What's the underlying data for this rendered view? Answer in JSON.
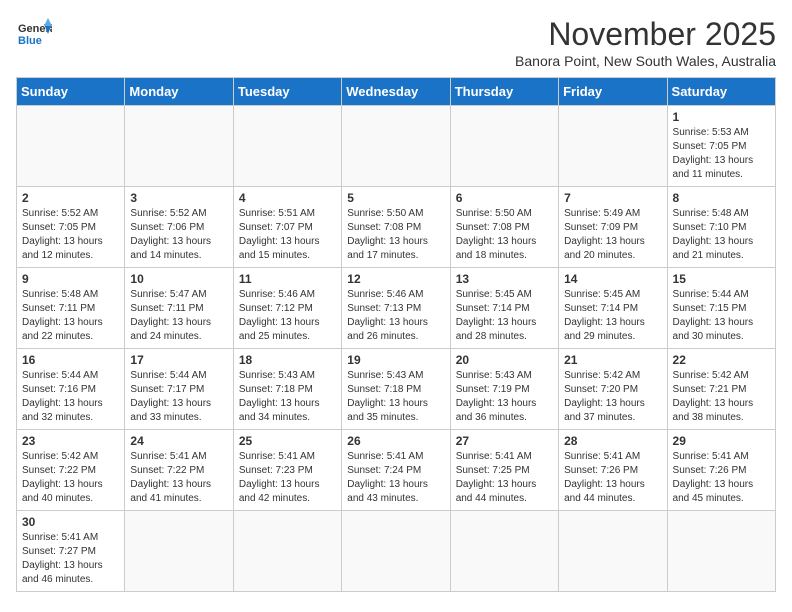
{
  "header": {
    "logo_general": "General",
    "logo_blue": "Blue",
    "month_title": "November 2025",
    "subtitle": "Banora Point, New South Wales, Australia"
  },
  "days_of_week": [
    "Sunday",
    "Monday",
    "Tuesday",
    "Wednesday",
    "Thursday",
    "Friday",
    "Saturday"
  ],
  "weeks": [
    [
      {
        "day": "",
        "info": ""
      },
      {
        "day": "",
        "info": ""
      },
      {
        "day": "",
        "info": ""
      },
      {
        "day": "",
        "info": ""
      },
      {
        "day": "",
        "info": ""
      },
      {
        "day": "",
        "info": ""
      },
      {
        "day": "1",
        "info": "Sunrise: 5:53 AM\nSunset: 7:05 PM\nDaylight: 13 hours and 11 minutes."
      }
    ],
    [
      {
        "day": "2",
        "info": "Sunrise: 5:52 AM\nSunset: 7:05 PM\nDaylight: 13 hours and 12 minutes."
      },
      {
        "day": "3",
        "info": "Sunrise: 5:52 AM\nSunset: 7:06 PM\nDaylight: 13 hours and 14 minutes."
      },
      {
        "day": "4",
        "info": "Sunrise: 5:51 AM\nSunset: 7:07 PM\nDaylight: 13 hours and 15 minutes."
      },
      {
        "day": "5",
        "info": "Sunrise: 5:50 AM\nSunset: 7:08 PM\nDaylight: 13 hours and 17 minutes."
      },
      {
        "day": "6",
        "info": "Sunrise: 5:50 AM\nSunset: 7:08 PM\nDaylight: 13 hours and 18 minutes."
      },
      {
        "day": "7",
        "info": "Sunrise: 5:49 AM\nSunset: 7:09 PM\nDaylight: 13 hours and 20 minutes."
      },
      {
        "day": "8",
        "info": "Sunrise: 5:48 AM\nSunset: 7:10 PM\nDaylight: 13 hours and 21 minutes."
      }
    ],
    [
      {
        "day": "9",
        "info": "Sunrise: 5:48 AM\nSunset: 7:11 PM\nDaylight: 13 hours and 22 minutes."
      },
      {
        "day": "10",
        "info": "Sunrise: 5:47 AM\nSunset: 7:11 PM\nDaylight: 13 hours and 24 minutes."
      },
      {
        "day": "11",
        "info": "Sunrise: 5:46 AM\nSunset: 7:12 PM\nDaylight: 13 hours and 25 minutes."
      },
      {
        "day": "12",
        "info": "Sunrise: 5:46 AM\nSunset: 7:13 PM\nDaylight: 13 hours and 26 minutes."
      },
      {
        "day": "13",
        "info": "Sunrise: 5:45 AM\nSunset: 7:14 PM\nDaylight: 13 hours and 28 minutes."
      },
      {
        "day": "14",
        "info": "Sunrise: 5:45 AM\nSunset: 7:14 PM\nDaylight: 13 hours and 29 minutes."
      },
      {
        "day": "15",
        "info": "Sunrise: 5:44 AM\nSunset: 7:15 PM\nDaylight: 13 hours and 30 minutes."
      }
    ],
    [
      {
        "day": "16",
        "info": "Sunrise: 5:44 AM\nSunset: 7:16 PM\nDaylight: 13 hours and 32 minutes."
      },
      {
        "day": "17",
        "info": "Sunrise: 5:44 AM\nSunset: 7:17 PM\nDaylight: 13 hours and 33 minutes."
      },
      {
        "day": "18",
        "info": "Sunrise: 5:43 AM\nSunset: 7:18 PM\nDaylight: 13 hours and 34 minutes."
      },
      {
        "day": "19",
        "info": "Sunrise: 5:43 AM\nSunset: 7:18 PM\nDaylight: 13 hours and 35 minutes."
      },
      {
        "day": "20",
        "info": "Sunrise: 5:43 AM\nSunset: 7:19 PM\nDaylight: 13 hours and 36 minutes."
      },
      {
        "day": "21",
        "info": "Sunrise: 5:42 AM\nSunset: 7:20 PM\nDaylight: 13 hours and 37 minutes."
      },
      {
        "day": "22",
        "info": "Sunrise: 5:42 AM\nSunset: 7:21 PM\nDaylight: 13 hours and 38 minutes."
      }
    ],
    [
      {
        "day": "23",
        "info": "Sunrise: 5:42 AM\nSunset: 7:22 PM\nDaylight: 13 hours and 40 minutes."
      },
      {
        "day": "24",
        "info": "Sunrise: 5:41 AM\nSunset: 7:22 PM\nDaylight: 13 hours and 41 minutes."
      },
      {
        "day": "25",
        "info": "Sunrise: 5:41 AM\nSunset: 7:23 PM\nDaylight: 13 hours and 42 minutes."
      },
      {
        "day": "26",
        "info": "Sunrise: 5:41 AM\nSunset: 7:24 PM\nDaylight: 13 hours and 43 minutes."
      },
      {
        "day": "27",
        "info": "Sunrise: 5:41 AM\nSunset: 7:25 PM\nDaylight: 13 hours and 44 minutes."
      },
      {
        "day": "28",
        "info": "Sunrise: 5:41 AM\nSunset: 7:26 PM\nDaylight: 13 hours and 44 minutes."
      },
      {
        "day": "29",
        "info": "Sunrise: 5:41 AM\nSunset: 7:26 PM\nDaylight: 13 hours and 45 minutes."
      }
    ],
    [
      {
        "day": "30",
        "info": "Sunrise: 5:41 AM\nSunset: 7:27 PM\nDaylight: 13 hours and 46 minutes."
      },
      {
        "day": "",
        "info": ""
      },
      {
        "day": "",
        "info": ""
      },
      {
        "day": "",
        "info": ""
      },
      {
        "day": "",
        "info": ""
      },
      {
        "day": "",
        "info": ""
      },
      {
        "day": "",
        "info": ""
      }
    ]
  ]
}
